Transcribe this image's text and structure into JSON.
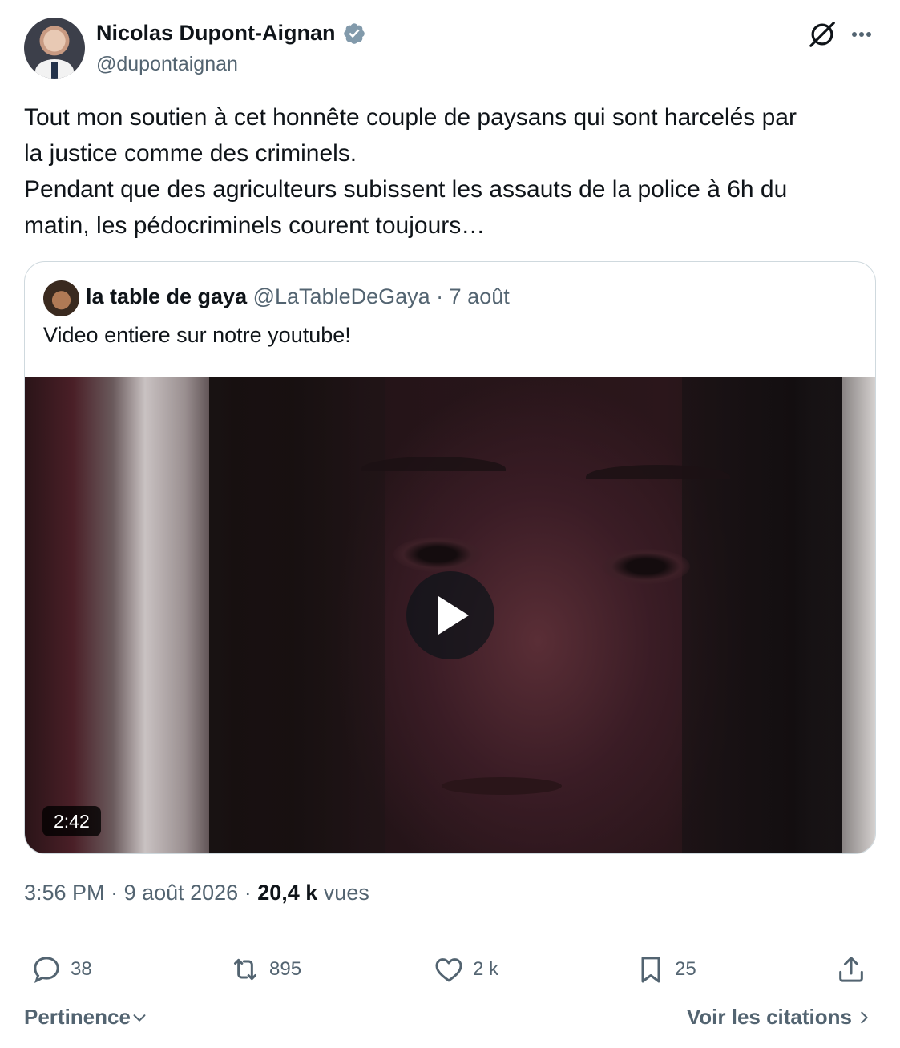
{
  "author": {
    "name": "Nicolas Dupont-Aignan",
    "handle": "@dupontaignan",
    "verified": true
  },
  "tweet": {
    "text": "Tout mon soutien à cet honnête couple de paysans qui sont harcelés par\nla justice comme des criminels.\nPendant que des agriculteurs subissent les assauts de la police à 6h du\nmatin, les pédocriminels courent toujours…",
    "time": "3:56 PM",
    "separator": " · ",
    "date": "9 août 2026",
    "views_count": "20,4 k",
    "views_label": "vues"
  },
  "quoted": {
    "name": "la table de gaya",
    "handle": "@LaTableDeGaya",
    "date": "7 août",
    "text": "Video entiere sur notre youtube!",
    "video_duration": "2:42"
  },
  "actions": {
    "replies": "38",
    "reposts": "895",
    "likes": "2 k",
    "bookmarks": "25"
  },
  "footer": {
    "sort_label": "Pertinence",
    "quotes_label": "Voir les citations"
  },
  "colors": {
    "text_primary": "#0f1419",
    "text_secondary": "#536471",
    "border": "#cfd9de",
    "verified_badge": "#829aab"
  },
  "icons": [
    "verified-badge-icon",
    "grok-icon",
    "more-icon",
    "play-icon",
    "reply-icon",
    "repost-icon",
    "like-icon",
    "bookmark-icon",
    "share-icon",
    "chevron-down-icon",
    "chevron-right-icon"
  ]
}
